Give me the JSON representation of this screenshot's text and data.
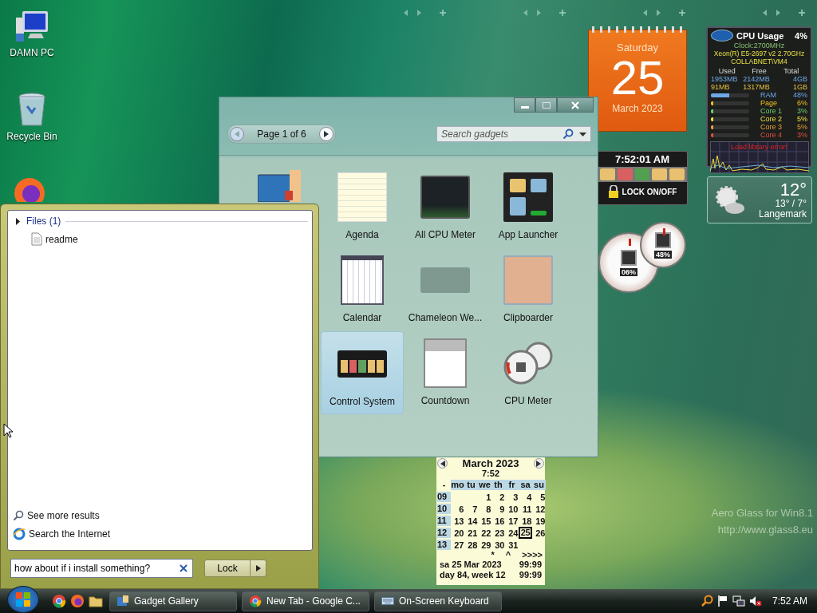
{
  "desktop_icons": [
    {
      "label": "DAMN PC",
      "kind": "computer"
    },
    {
      "label": "Recycle Bin",
      "kind": "recycle"
    }
  ],
  "gadget_gallery": {
    "page_label": "Page 1 of 6",
    "search": {
      "placeholder": "Search gadgets"
    },
    "gadgets": [
      {
        "name": "Agenda",
        "kind": "agenda",
        "selected": false
      },
      {
        "name": "All CPU Meter",
        "kind": "cpu",
        "selected": false
      },
      {
        "name": "App Launcher",
        "kind": "launcher",
        "selected": false
      },
      {
        "name": "Calendar",
        "kind": "calendar",
        "selected": false
      },
      {
        "name": "Chameleon We...",
        "kind": "weather",
        "selected": false
      },
      {
        "name": "Clipboarder",
        "kind": "photo",
        "selected": false
      },
      {
        "name": "Control System",
        "kind": "control",
        "selected": true
      },
      {
        "name": "Countdown",
        "kind": "countdown",
        "selected": false
      },
      {
        "name": "CPU Meter",
        "kind": "gauge",
        "selected": false
      }
    ]
  },
  "start_menu": {
    "group": {
      "label": "Files (1)",
      "expanded": false,
      "items": [
        "readme"
      ]
    },
    "links": [
      "See more results",
      "Search the Internet"
    ],
    "search": {
      "value": "how about if i install something?"
    },
    "power_button": "Lock"
  },
  "date_gadget": {
    "weekday": "Saturday",
    "day": "25",
    "month": "March 2023"
  },
  "control_gadget": {
    "time": "7:52:01 AM",
    "lock_label": "LOCK ON/OFF"
  },
  "gauges": [
    {
      "reading": "06%"
    },
    {
      "reading": "48%"
    }
  ],
  "cpu_gadget": {
    "title": "CPU Usage",
    "total": "4%",
    "clock": "Clock:2700MHz",
    "cpu": "Xeon(R) E5-2697 v2 2.70GHz",
    "host": "COLLABNET\\VM4",
    "headers": [
      "Used",
      "Free",
      "Total"
    ],
    "memory_rows": [
      {
        "cells": [
          "1953MB",
          "2142MB",
          "4GB"
        ]
      },
      {
        "cells": [
          "91MB",
          "1317MB",
          "1GB"
        ]
      }
    ],
    "meters": [
      {
        "label": "RAM",
        "value": "48%",
        "level": 0.48,
        "color": "#6fa8e8"
      },
      {
        "label": "Page",
        "value": "6%",
        "level": 0.06,
        "color": "#f0c020"
      },
      {
        "label": "Core 1",
        "value": "3%",
        "level": 0.03,
        "color": "#70d070"
      },
      {
        "label": "Core 2",
        "value": "5%",
        "level": 0.05,
        "color": "#f0e040"
      },
      {
        "label": "Core 3",
        "value": "5%",
        "level": 0.05,
        "color": "#e8a030"
      },
      {
        "label": "Core 4",
        "value": "3%",
        "level": 0.03,
        "color": "#e05040"
      }
    ],
    "error": "Load library error!"
  },
  "weather": {
    "temperature": "12°",
    "range": "13° / 7°",
    "place": "Langemark"
  },
  "agenda": {
    "title": "March 2023",
    "time": "7:52",
    "headers": [
      "-",
      "mo",
      "tu",
      "we",
      "th",
      "fr",
      "sa",
      "su"
    ],
    "weeks": [
      {
        "week": "09",
        "days": [
          {
            "d": "1",
            "selected": false
          },
          {
            "d": "2",
            "selected": false
          },
          {
            "d": "3",
            "selected": false
          },
          {
            "d": "4",
            "selected": false
          },
          {
            "d": "5",
            "selected": false
          }
        ]
      },
      {
        "week": "10",
        "days": [
          {
            "d": "6",
            "selected": false
          },
          {
            "d": "7",
            "selected": false
          },
          {
            "d": "8",
            "selected": false
          },
          {
            "d": "9",
            "selected": false
          },
          {
            "d": "10",
            "selected": false
          },
          {
            "d": "11",
            "selected": false
          },
          {
            "d": "12",
            "selected": false
          }
        ]
      },
      {
        "week": "11",
        "days": [
          {
            "d": "13",
            "selected": false
          },
          {
            "d": "14",
            "selected": false
          },
          {
            "d": "15",
            "selected": false
          },
          {
            "d": "16",
            "selected": false
          },
          {
            "d": "17",
            "selected": false
          },
          {
            "d": "18",
            "selected": false
          },
          {
            "d": "19",
            "selected": false
          }
        ]
      },
      {
        "week": "12",
        "days": [
          {
            "d": "20",
            "selected": false
          },
          {
            "d": "21",
            "selected": false
          },
          {
            "d": "22",
            "selected": false
          },
          {
            "d": "23",
            "selected": false
          },
          {
            "d": "24",
            "selected": false
          },
          {
            "d": "25",
            "selected": true
          },
          {
            "d": "26",
            "selected": false
          }
        ]
      },
      {
        "week": "13",
        "days": [
          {
            "d": "27",
            "selected": false
          },
          {
            "d": "28",
            "selected": false
          },
          {
            "d": "29",
            "selected": false
          },
          {
            "d": "30",
            "selected": false
          },
          {
            "d": "31",
            "selected": false
          }
        ]
      }
    ],
    "nav": [
      "*",
      "^",
      ">>>>"
    ],
    "footer": [
      {
        "left": "sa 25 Mar 2023",
        "right": "99:99"
      },
      {
        "left": "day 84, week 12",
        "right": "99:99"
      }
    ]
  },
  "watermark": [
    "Aero Glass for Win8.1",
    "http://www.glass8.eu"
  ],
  "taskbar": {
    "tasks": [
      {
        "label": "Gadget Gallery",
        "kind": "gallery"
      },
      {
        "label": "New Tab - Google C...",
        "kind": "chrome"
      },
      {
        "label": "On-Screen Keyboard",
        "kind": "keyboard"
      }
    ],
    "clock": "7:52 AM"
  }
}
